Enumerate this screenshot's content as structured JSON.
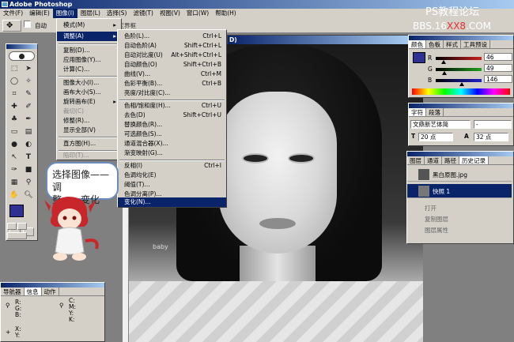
{
  "app": {
    "title": "Adobe Photoshop"
  },
  "menubar": [
    {
      "label": "文件(F)"
    },
    {
      "label": "编辑(E)"
    },
    {
      "label": "图像(I)",
      "active": true
    },
    {
      "label": "图层(L)"
    },
    {
      "label": "选择(S)"
    },
    {
      "label": "滤镜(T)"
    },
    {
      "label": "视图(V)"
    },
    {
      "label": "窗口(W)"
    },
    {
      "label": "帮助(H)"
    }
  ],
  "optionsbar": {
    "auto_select_label": "自动",
    "bounds_label": "示定界框"
  },
  "document": {
    "title_fragment": "D)"
  },
  "image_menu": {
    "items": [
      {
        "label": "模式(M)",
        "submenu": true
      },
      {
        "label": "调整(A)",
        "submenu": true,
        "highlighted": true
      },
      {
        "label": "复制(D)..."
      },
      {
        "label": "应用图像(Y)..."
      },
      {
        "label": "计算(C)..."
      },
      {
        "label": "图像大小(I)..."
      },
      {
        "label": "画布大小(S)..."
      },
      {
        "label": "旋转画布(E)",
        "submenu": true
      },
      {
        "label": "裁切(C)",
        "disabled": true
      },
      {
        "label": "修整(R)..."
      },
      {
        "label": "显示全部(V)"
      },
      {
        "label": "直方图(H)..."
      },
      {
        "label": "陷印(T)...",
        "disabled": true
      }
    ]
  },
  "adjust_menu": {
    "items": [
      {
        "label": "色阶(L)...",
        "shortcut": "Ctrl+L"
      },
      {
        "label": "自动色阶(A)",
        "shortcut": "Shift+Ctrl+L"
      },
      {
        "label": "自动对比度(U)",
        "shortcut": "Alt+Shift+Ctrl+L"
      },
      {
        "label": "自动颜色(O)",
        "shortcut": "Shift+Ctrl+B"
      },
      {
        "label": "曲线(V)...",
        "shortcut": "Ctrl+M"
      },
      {
        "label": "色彩平衡(B)...",
        "shortcut": "Ctrl+B"
      },
      {
        "label": "亮度/对比度(C)...",
        "shortcut": ""
      },
      {
        "label": "色相/饱和度(H)...",
        "shortcut": "Ctrl+U"
      },
      {
        "label": "去色(D)",
        "shortcut": "Shift+Ctrl+U"
      },
      {
        "label": "替换颜色(R)...",
        "shortcut": ""
      },
      {
        "label": "可选颜色(S)...",
        "shortcut": ""
      },
      {
        "label": "通道混合器(X)...",
        "shortcut": ""
      },
      {
        "label": "渐变映射(G)...",
        "shortcut": ""
      },
      {
        "label": "反相(I)",
        "shortcut": "Ctrl+I"
      },
      {
        "label": "色调均化(E)",
        "shortcut": ""
      },
      {
        "label": "阈值(T)...",
        "shortcut": ""
      },
      {
        "label": "色调分离(P)...",
        "shortcut": ""
      },
      {
        "label": "变化(N)...",
        "shortcut": "",
        "highlighted": true
      }
    ]
  },
  "color_panel": {
    "tabs": [
      "颜色",
      "色板",
      "样式",
      "工具预设"
    ],
    "channels": [
      {
        "name": "R",
        "value": "46",
        "level": 0.18,
        "color": "#cc2020"
      },
      {
        "name": "G",
        "value": "49",
        "level": 0.19,
        "color": "#20a020"
      },
      {
        "name": "B",
        "value": "146",
        "level": 0.57,
        "color": "#2020cc"
      }
    ],
    "foreground": "#2e3192"
  },
  "type_panel": {
    "tabs": [
      "字符",
      "段落"
    ],
    "font": "文鼎新艺体简",
    "style": "-",
    "size": "20 点",
    "leading": "32 点"
  },
  "layers_panel": {
    "tabs": [
      "图层",
      "通道",
      "路径",
      "历史记录"
    ],
    "snapshot": "黑白原图.jpg",
    "selected": "快照 1",
    "history": [
      "打开",
      "复制图层",
      "图层属性"
    ]
  },
  "info_panel": {
    "tabs": [
      "导航器",
      "信息",
      "动作"
    ],
    "left_labels": [
      "R:",
      "G:",
      "B:"
    ],
    "right_labels": [
      "C:",
      "M:",
      "Y:",
      "K:"
    ],
    "xy_labels": [
      "X:",
      "Y:"
    ]
  },
  "callout": {
    "line1": "选择图像——调",
    "line2": "整——变化"
  },
  "watermarks": {
    "top": "PS教程论坛",
    "url_a": "BBS.16",
    "url_b": "XX8",
    "url_c": ".COM"
  },
  "photo_text": "baby"
}
